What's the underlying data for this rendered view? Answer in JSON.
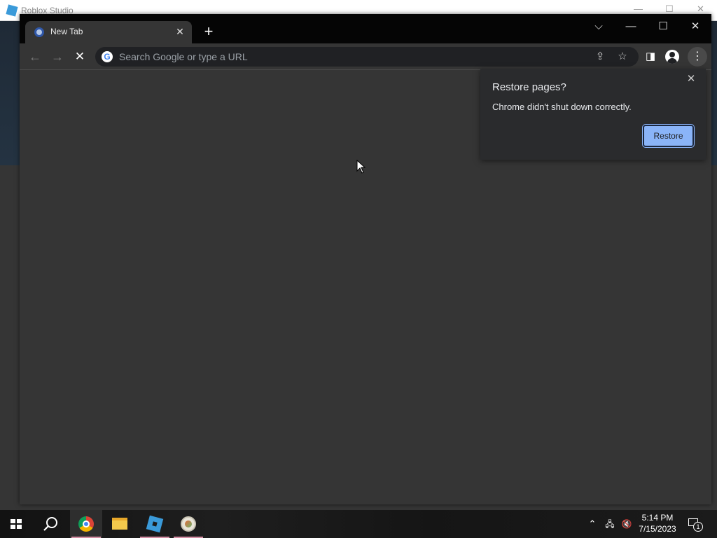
{
  "background_window": {
    "title": "Roblox Studio",
    "controls": [
      "—",
      "☐",
      "✕"
    ]
  },
  "browser": {
    "tab": {
      "title": "New Tab",
      "close": "✕"
    },
    "new_tab": "+",
    "window_controls": {
      "tab_search": "⌵",
      "minimize": "—",
      "maximize": "☐",
      "close": "✕"
    },
    "nav": {
      "back": "←",
      "forward": "→",
      "stop": "✕"
    },
    "omnibox": {
      "placeholder": "Search Google or type a URL",
      "value": "",
      "google_glyph": "G"
    },
    "toolbar_icons": {
      "share": "⇪",
      "bookmark": "☆",
      "side_panel": "◨",
      "menu": "⋮"
    }
  },
  "restore_bubble": {
    "title": "Restore pages?",
    "message": "Chrome didn't shut down correctly.",
    "close": "✕",
    "button_label": "Restore"
  },
  "taskbar": {
    "apps": [
      "start-icon",
      "search-icon",
      "chrome-icon",
      "file-explorer-icon",
      "roblox-studio-icon",
      "app-icon"
    ],
    "tray": {
      "chevron": "⌃",
      "network": "🖧",
      "volume": "🔇"
    },
    "time": "5:14 PM",
    "date": "7/15/2023",
    "notification_count": "1"
  }
}
